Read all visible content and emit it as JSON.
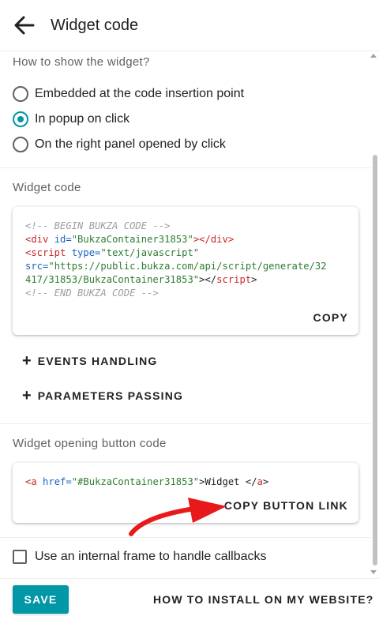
{
  "header": {
    "title": "Widget code"
  },
  "display_mode": {
    "label": "How to show the widget?",
    "options": [
      {
        "label": "Embedded at the code insertion point",
        "checked": false
      },
      {
        "label": "In popup on click",
        "checked": true
      },
      {
        "label": "On the right panel opened by click",
        "checked": false
      }
    ]
  },
  "widget_code": {
    "label": "Widget code",
    "lines": {
      "l1": "<!-- BEGIN BUKZA CODE -->",
      "l2_tag_open": "<div",
      "l2_attr": " id=",
      "l2_value": "\"BukzaContainer31853\"",
      "l2_close": "></div>",
      "l3_tag": "<script",
      "l3_attr": " type=",
      "l3_value": "\"text/javascript\"",
      "l4_attr": "src=",
      "l4_value": "\"https://public.bukza.com/api/script/generate/32",
      "l5_value": "417/31853/BukzaContainer31853\"",
      "l5_close": "></",
      "l5_tag": "script",
      "l5_end": ">",
      "l6": "<!-- END BUKZA CODE -->"
    },
    "copy_label": "COPY"
  },
  "expanders": {
    "events": "EVENTS HANDLING",
    "parameters": "PARAMETERS PASSING"
  },
  "button_code": {
    "label": "Widget opening button code",
    "code": {
      "tag_open": "<a",
      "attr": " href=",
      "value": "\"#BukzaContainer31853\"",
      "text": ">Widget </",
      "tag_close": "a",
      "end": ">"
    },
    "copy_label": "COPY BUTTON LINK"
  },
  "iframe_option": {
    "label": "Use an internal frame to handle callbacks",
    "checked": false
  },
  "footer": {
    "save_label": "SAVE",
    "howto_label": "HOW TO INSTALL ON MY WEBSITE?"
  },
  "colors": {
    "accent": "#0097a7",
    "annotation_arrow": "#e8191b"
  }
}
